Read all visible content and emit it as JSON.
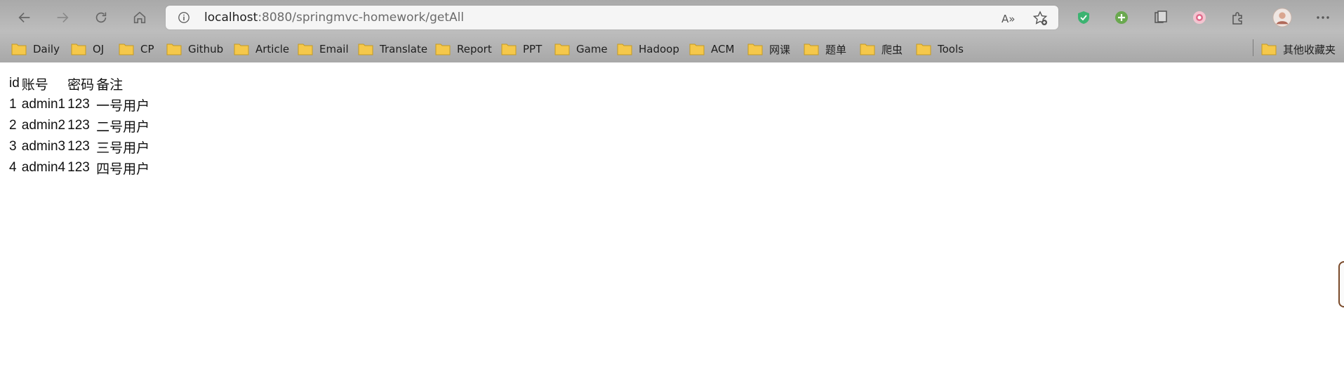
{
  "browser": {
    "url_host": "localhost",
    "url_rest": ":8080/springmvc-homework/getAll",
    "read_aloud_label": "A»"
  },
  "bookmarks": [
    "Daily",
    "OJ",
    "CP",
    "Github",
    "Article",
    "Email",
    "Translate",
    "Report",
    "PPT",
    "Game",
    "Hadoop",
    "ACM",
    "网课",
    "题单",
    "爬虫",
    "Tools"
  ],
  "other_bookmarks": "其他收藏夹",
  "table": {
    "headers": [
      "id",
      "账号",
      "密码",
      "备注"
    ],
    "rows": [
      [
        "1",
        "admin1",
        "123",
        "一号用户"
      ],
      [
        "2",
        "admin2",
        "123",
        "二号用户"
      ],
      [
        "3",
        "admin3",
        "123",
        "三号用户"
      ],
      [
        "4",
        "admin4",
        "123",
        "四号用户"
      ]
    ]
  },
  "colors": {
    "folder": "#f5c84b",
    "shield": "#3cb371",
    "plus_ext": "#6aa84f",
    "record_ext": "#e88aa0"
  }
}
